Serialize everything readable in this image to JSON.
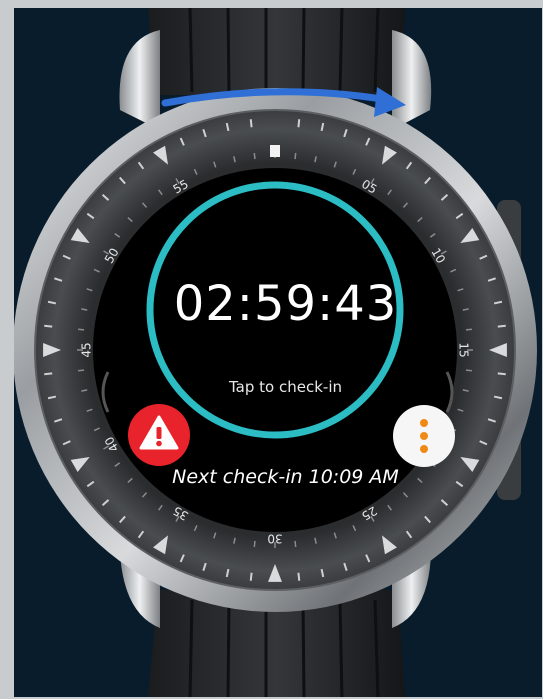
{
  "watch": {
    "timer": "02:59:43",
    "tap_label": "Tap to check-in",
    "next_checkin": "Next check-in 10:09 AM",
    "bezel_numbers": [
      "55",
      "05",
      "10",
      "15",
      "20",
      "25",
      "30",
      "35",
      "40",
      "45",
      "50"
    ]
  },
  "icons": {
    "alert": "warning-triangle-icon",
    "more": "vertical-dots-icon",
    "rotate": "rotate-arrow-icon"
  },
  "colors": {
    "background": "#081c2c",
    "ring": "#2bbcc4",
    "alert": "#e8232b",
    "more_dots": "#f08a17",
    "arrow": "#2f6fd6"
  }
}
